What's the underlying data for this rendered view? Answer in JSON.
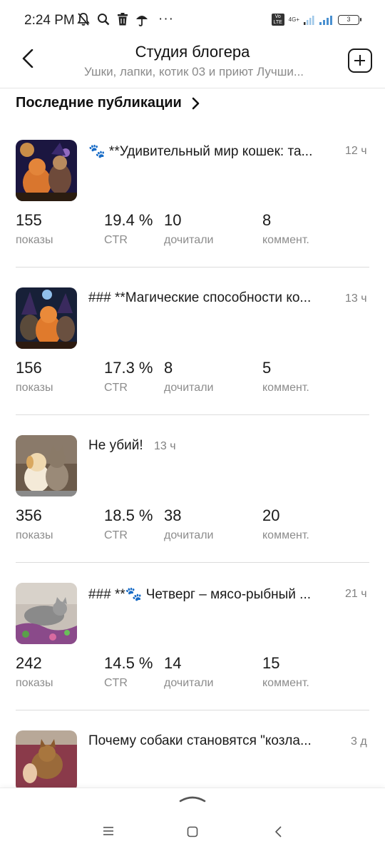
{
  "status_bar": {
    "time": "2:24 PM",
    "icons": [
      "mute-bell-icon",
      "search-icon",
      "trash-icon",
      "umbrella-icon"
    ],
    "more": "···",
    "volte": "Vo LTE",
    "network": "4G+",
    "battery": "3"
  },
  "header": {
    "title": "Студия блогера",
    "subtitle": "Ушки, лапки, котик 03 и приют Лучши...",
    "back_icon": "back-arrow-icon",
    "add_icon": "add-square-icon"
  },
  "section": {
    "title": "Последние публикации",
    "chevron_icon": "chevron-right-icon"
  },
  "posts": [
    {
      "title": "🐾 **Удивительный мир кошек: та...",
      "time": "12 ч",
      "stats": {
        "views": "155",
        "views_label": "показы",
        "ctr": "19.4 %",
        "ctr_label": "CTR",
        "read": "10",
        "read_label": "дочитали",
        "comments": "8",
        "comments_label": "коммент."
      }
    },
    {
      "title": "### **Магические способности ко...",
      "time": "13 ч",
      "stats": {
        "views": "156",
        "views_label": "показы",
        "ctr": "17.3 %",
        "ctr_label": "CTR",
        "read": "8",
        "read_label": "дочитали",
        "comments": "5",
        "comments_label": "коммент."
      }
    },
    {
      "title": "Не убий!",
      "time": "13 ч",
      "stats": {
        "views": "356",
        "views_label": "показы",
        "ctr": "18.5 %",
        "ctr_label": "CTR",
        "read": "38",
        "read_label": "дочитали",
        "comments": "20",
        "comments_label": "коммент."
      }
    },
    {
      "title": "### **🐾 Четверг – мясо-рыбный ...",
      "time": "21 ч",
      "stats": {
        "views": "242",
        "views_label": "показы",
        "ctr": "14.5 %",
        "ctr_label": "CTR",
        "read": "14",
        "read_label": "дочитали",
        "comments": "15",
        "comments_label": "коммент."
      }
    },
    {
      "title": "Почему собаки становятся \"козла...",
      "time": "3 д"
    }
  ],
  "nav": {
    "menu_icon": "menu-icon",
    "home_icon": "home-square-icon",
    "back_icon": "nav-back-icon"
  }
}
